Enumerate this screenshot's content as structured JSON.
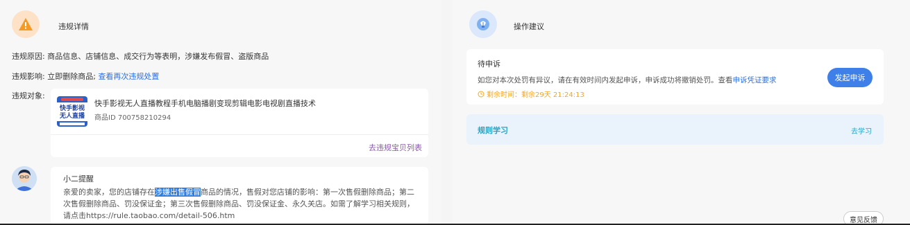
{
  "violation": {
    "section_title": "违规详情",
    "reason_label": "违规原因:",
    "reason_value": "商品信息、店铺信息、成交行为等表明，涉嫌发布假冒、盗版商品",
    "impact_label": "违规影响:",
    "impact_value": "立即删除商品;",
    "impact_link": "查看再次违规处置",
    "object_label": "违规对象:",
    "product": {
      "title": "快手影视无人直播教程手机电脑播剧变现剪辑电影电视剧直播技术",
      "id_text": "商品ID 700758210294",
      "thumb_text_1": "快手影视",
      "thumb_text_2": "无人直播"
    },
    "list_link": "去违规宝贝列表"
  },
  "reminder": {
    "title": "小二提醒",
    "text_before": "亲爱的卖家，您的店铺存在",
    "text_highlight": "涉嫌出售假冒",
    "text_after": "商品的情况，售假对您店铺的影响：第一次售假删除商品；第二次售假删除商品、罚没保证金；第三次售假删除商品、罚没保证金、永久关店。如需了解学习相关规则，请点击https://rule.taobao.com/detail-506.htm"
  },
  "suggestion": {
    "section_title": "操作建议",
    "appeal_status": "待申诉",
    "appeal_desc": "如您对本次处罚有异议，请在有效时间内发起申诉，申诉成功将撤销处罚。查看",
    "appeal_link": "申诉凭证要求",
    "timer_text": "剩余时间：剩余29天 21:24:13",
    "appeal_button": "发起申诉",
    "rule_title": "规则学习",
    "rule_link": "去学习"
  },
  "feedback_label": "意见反馈",
  "colors": {
    "accent_blue": "#3e7fe8",
    "link_blue": "#2f6fde",
    "warning_orange": "#f5a623",
    "rule_teal": "#2ba2c4"
  },
  "icons": {
    "left": "warning-triangle-icon",
    "right": "lightbulb-icon",
    "timer": "clock-icon"
  }
}
